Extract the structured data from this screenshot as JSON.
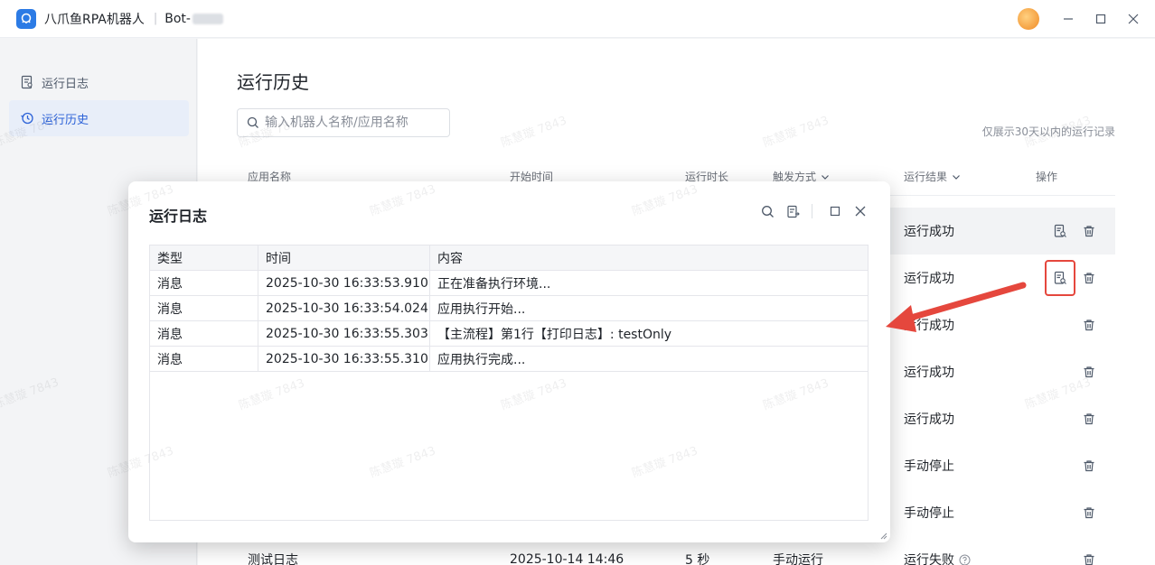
{
  "titlebar": {
    "app_name": "八爪鱼RPA机器人",
    "bot_prefix": "Bot-"
  },
  "sidebar": {
    "items": [
      {
        "label": "运行日志"
      },
      {
        "label": "运行历史"
      }
    ]
  },
  "main": {
    "title": "运行历史",
    "search_placeholder": "输入机器人名称/应用名称",
    "hint": "仅展示30天以内的运行记录",
    "columns": {
      "app_name": "应用名称",
      "start_time": "开始时间",
      "duration": "运行时长",
      "trigger": "触发方式",
      "result": "运行结果",
      "ops": "操作"
    },
    "rows": [
      {
        "result": "运行成功"
      },
      {
        "result": "运行成功"
      },
      {
        "result": "运行成功"
      },
      {
        "result": "运行成功"
      },
      {
        "result": "运行成功"
      },
      {
        "result": "手动停止"
      },
      {
        "result": "手动停止"
      },
      {
        "app_name": "测试日志",
        "start_time": "2025-10-14 14:46",
        "duration": "5 秒",
        "trigger": "手动运行",
        "result": "运行失败"
      }
    ]
  },
  "watermark": "陈慧璇 7843",
  "modal": {
    "title": "运行日志",
    "columns": {
      "type": "类型",
      "time": "时间",
      "content": "内容"
    },
    "logs": [
      {
        "type": "消息",
        "time": "2025-10-30 16:33:53.910",
        "content": "正在准备执行环境..."
      },
      {
        "type": "消息",
        "time": "2025-10-30 16:33:54.024",
        "content": "应用执行开始..."
      },
      {
        "type": "消息",
        "time": "2025-10-30 16:33:55.303",
        "content": "【主流程】第1行【打印日志】: testOnly"
      },
      {
        "type": "消息",
        "time": "2025-10-30 16:33:55.310",
        "content": "应用执行完成..."
      }
    ]
  },
  "colors": {
    "accent": "#2c62d8",
    "highlight": "#e5473d"
  }
}
